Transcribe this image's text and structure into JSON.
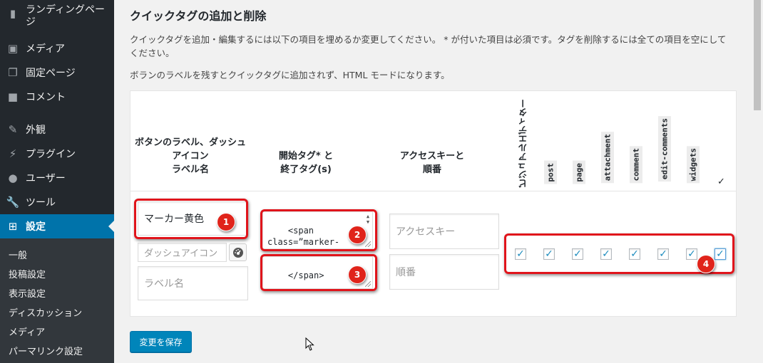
{
  "sidebar": {
    "items": [
      {
        "label": "ランディングページ",
        "icon": "page-icon"
      },
      {
        "label": "メディア",
        "icon": "media-icon"
      },
      {
        "label": "固定ページ",
        "icon": "pages-icon"
      },
      {
        "label": "コメント",
        "icon": "comment-icon"
      },
      {
        "label": "外観",
        "icon": "brush-icon"
      },
      {
        "label": "プラグイン",
        "icon": "plugin-icon"
      },
      {
        "label": "ユーザー",
        "icon": "user-icon"
      },
      {
        "label": "ツール",
        "icon": "wrench-icon"
      },
      {
        "label": "設定",
        "icon": "settings-icon"
      }
    ],
    "submenu": [
      "一般",
      "投稿設定",
      "表示設定",
      "ディスカッション",
      "メディア",
      "パーマリンク設定"
    ]
  },
  "main": {
    "title": "クイックタグの追加と削除",
    "desc1": "クイックタグを追加・編集するには以下の項目を埋めるか変更してください。 * が付いた項目は必須です。タグを削除するには全ての項目を空にしてください。",
    "desc2": "ボランのラベルを残すとクイックタグに追加されず、HTML モードになります。",
    "columns": {
      "label_col": "ボタンのラベル、ダッシュアイコン\nラベル名",
      "tag_col": "開始タグ* と\n終了タグ(s)",
      "access_col": "アクセスキーと\n順番",
      "visual_editor": "ビジュアルエディター",
      "post_types": [
        "post",
        "page",
        "attachment",
        "comment",
        "edit-comments",
        "widgets"
      ],
      "check_all": "✓"
    },
    "row": {
      "button_label": "マーカー黄色",
      "dashicon_placeholder": "ダッシュアイコン",
      "label_name_placeholder": "ラベル名",
      "start_tag": "<span\nclass=”marker-\nunder”>",
      "end_tag": "</span>",
      "access_key_placeholder": "アクセスキー",
      "order_placeholder": "順番",
      "checks": [
        true,
        true,
        true,
        true,
        true,
        true,
        true,
        true
      ]
    },
    "annotations": [
      "1",
      "2",
      "3",
      "4"
    ],
    "save_button": "変更を保存"
  },
  "colors": {
    "sidebar_bg": "#23282d",
    "submenu_bg": "#32373c",
    "active": "#0073aa",
    "annotation": "#e0141b",
    "save_button": "#0085ba"
  }
}
